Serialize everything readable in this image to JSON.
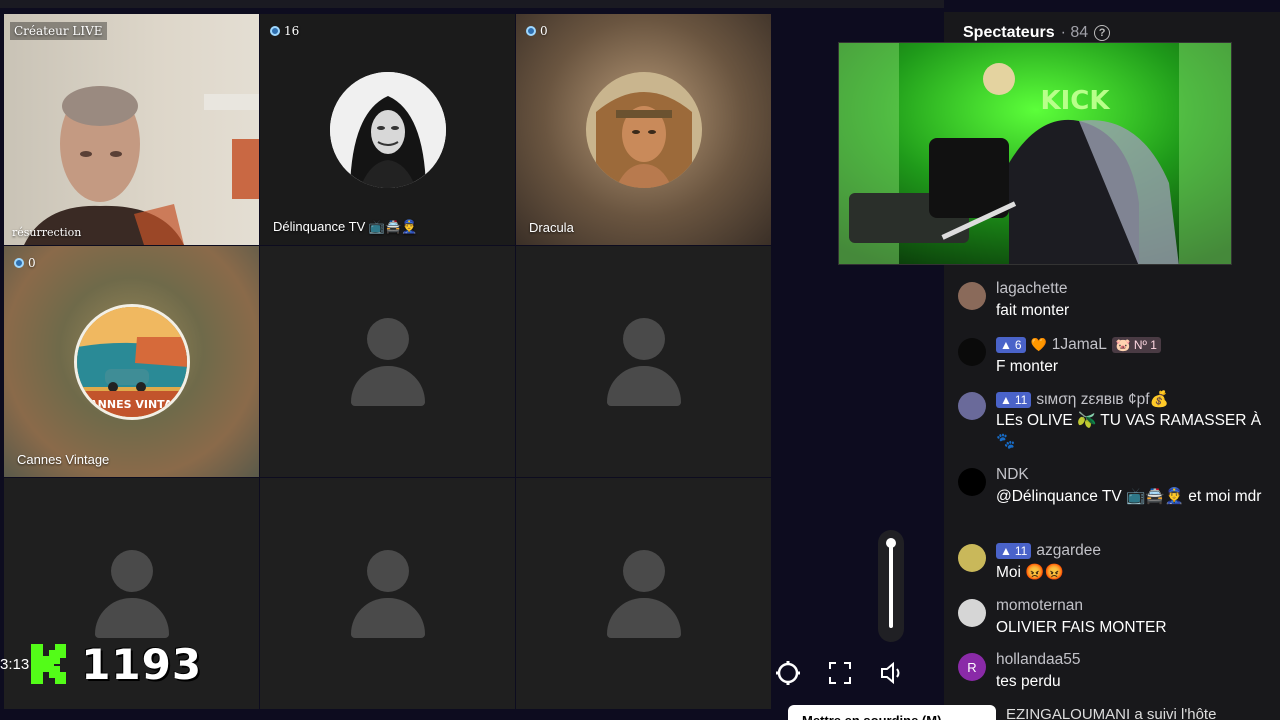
{
  "sidebar": {
    "title": "Spectateurs",
    "viewer_count": "· 84",
    "help_icon": "?"
  },
  "tiles": [
    {
      "badge": "Créateur LIVE",
      "name": "résurrection"
    },
    {
      "badge": "16",
      "name": "Délinquance TV 📺🚔👮‍♂️"
    },
    {
      "badge": "0",
      "name": "Dracula"
    },
    {
      "badge": "0",
      "name": "Cannes Vintage"
    }
  ],
  "overlay": {
    "timestamp": "3:13",
    "counter": "1193"
  },
  "preview": {
    "sign_text": "KICK"
  },
  "chat": [
    {
      "user": "lagachette",
      "text": "fait monter",
      "badges": []
    },
    {
      "user": "1JamaL",
      "text": "F monter",
      "badges": [
        "6"
      ],
      "extra_badge": "Nº 1"
    },
    {
      "user": "ѕιмση zεявιв ¢pf💰",
      "text": "LEs OLIVE 🫒 TU VAS RAMASSER À 🐾",
      "badges": [
        "11"
      ]
    },
    {
      "user": "NDK",
      "text": "@Délinquance TV 📺🚔👮‍♂️ et moi mdr",
      "badges": []
    },
    {
      "user": "azgardee",
      "text": "Moi 😡😡",
      "badges": [
        "11"
      ]
    },
    {
      "user": "momoternan",
      "text": "OLIVIER FAIS MONTER",
      "badges": []
    },
    {
      "user": "hollandaa55",
      "text": "tes perdu",
      "badges": []
    }
  ],
  "tooltip": "Mettre en sourdine (M)",
  "follow_text": "EZINGALOUMANI a suivi l'hôte",
  "colors": {
    "kick_green": "#53fc18",
    "badge_blue": "#4a63c9",
    "sidebar_bg": "#18181b"
  }
}
